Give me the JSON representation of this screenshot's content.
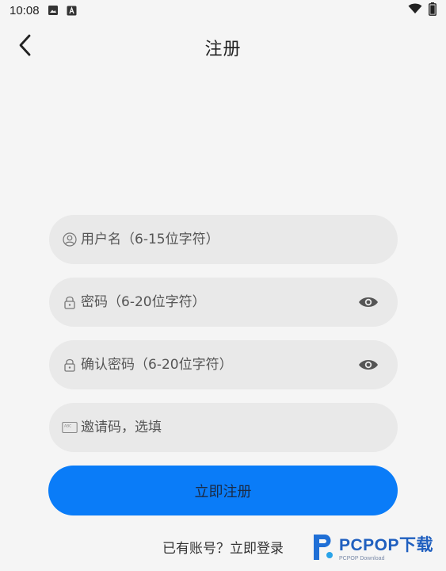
{
  "status_bar": {
    "time": "10:08"
  },
  "header": {
    "title": "注册"
  },
  "form": {
    "username_placeholder": "用户名（6-15位字符）",
    "password_placeholder": "密码（6-20位字符）",
    "confirm_placeholder": "确认密码（6-20位字符）",
    "invite_placeholder": "邀请码，选填"
  },
  "actions": {
    "submit_label": "立即注册",
    "login_link": "已有账号？立即登录"
  },
  "watermark": {
    "brand": "PCPOP下载",
    "sub": "PCPOP Download"
  },
  "colors": {
    "primary": "#0a7cf8",
    "background": "#f5f5f5",
    "field_bg": "#e9e9e9"
  },
  "icons": {
    "back": "chevron-left-icon",
    "user": "user-circle-icon",
    "lock": "lock-icon",
    "eye": "eye-icon",
    "invite": "abc-card-icon"
  }
}
